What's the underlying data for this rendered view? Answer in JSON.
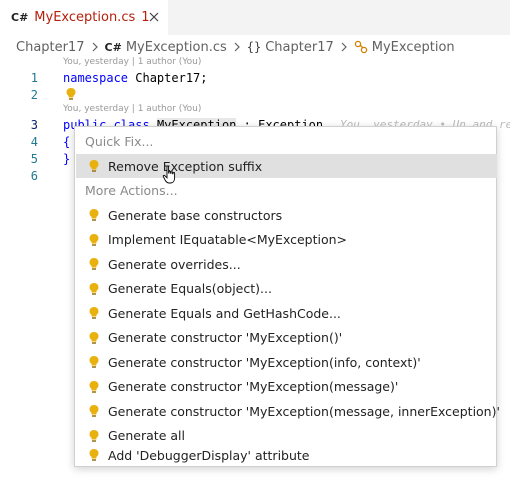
{
  "tab": {
    "lang_badge": "C#",
    "title": "MyException.cs",
    "problem_count": "1"
  },
  "breadcrumb": {
    "items": [
      "Chapter17",
      "MyException.cs",
      "Chapter17",
      "MyException"
    ],
    "cs_badge": "C#",
    "ns_glyph": "{}"
  },
  "editor": {
    "codelens_1": "You, yesterday | 1 author (You)",
    "codelens_2": "You, yesterday | 1 author (You)",
    "line_numbers": [
      "1",
      "2",
      "3",
      "4",
      "5",
      "6"
    ],
    "line1": {
      "keyword": "namespace",
      "rest": " Chapter17;"
    },
    "line3": {
      "keyword": "public class",
      "space": " ",
      "selected": "MyException",
      "rest": " : Exception"
    },
    "line4": "{",
    "line5": "}",
    "blame_ghost": "You, yesterday • Un and re"
  },
  "quick_fix_menu": {
    "quick_fix_header": "Quick Fix...",
    "quick_fix_items": [
      "Remove Exception suffix"
    ],
    "more_actions_header": "More Actions...",
    "more_actions_items": [
      "Generate base constructors",
      "Implement IEquatable<MyException>",
      "Generate overrides...",
      "Generate Equals(object)...",
      "Generate Equals and GetHashCode...",
      "Generate constructor 'MyException()'",
      "Generate constructor 'MyException(info, context)'",
      "Generate constructor 'MyException(message)'",
      "Generate constructor 'MyException(message, innerException)'",
      "Generate all",
      "Add 'DebuggerDisplay' attribute"
    ]
  },
  "colors": {
    "bulb": "#e8b10e",
    "error_text": "#b5200d",
    "keyword": "#0000ff",
    "line_number": "#237893",
    "highlight": "#e0e0e0"
  }
}
